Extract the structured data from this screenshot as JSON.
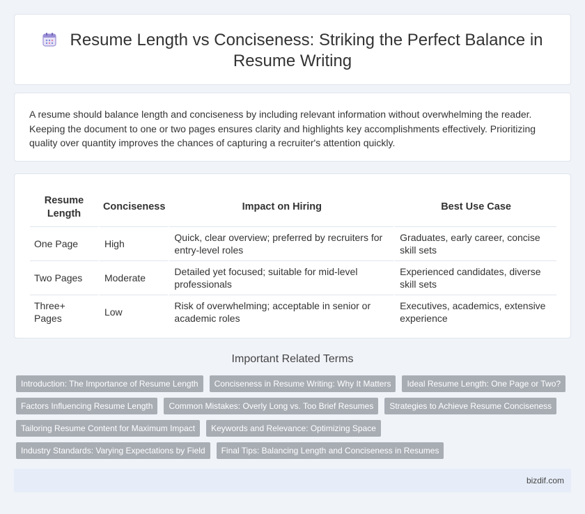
{
  "header": {
    "title": "Resume Length vs Conciseness: Striking the Perfect Balance in Resume Writing",
    "icon": "calendar-icon"
  },
  "intro": {
    "text": "A resume should balance length and conciseness by including relevant information without overwhelming the reader. Keeping the document to one or two pages ensures clarity and highlights key accomplishments effectively. Prioritizing quality over quantity improves the chances of capturing a recruiter's attention quickly."
  },
  "table": {
    "headers": [
      "Resume Length",
      "Conciseness",
      "Impact on Hiring",
      "Best Use Case"
    ],
    "rows": [
      [
        "One Page",
        "High",
        "Quick, clear overview; preferred by recruiters for entry-level roles",
        "Graduates, early career, concise skill sets"
      ],
      [
        "Two Pages",
        "Moderate",
        "Detailed yet focused; suitable for mid-level professionals",
        "Experienced candidates, diverse skill sets"
      ],
      [
        "Three+ Pages",
        "Low",
        "Risk of overwhelming; acceptable in senior or academic roles",
        "Executives, academics, extensive experience"
      ]
    ]
  },
  "related": {
    "title": "Important Related Terms",
    "tags": [
      [
        "Introduction: The Importance of Resume Length",
        "Conciseness in Resume Writing: Why It Matters",
        "Ideal Resume Length: One Page or Two?"
      ],
      [
        "Factors Influencing Resume Length",
        "Common Mistakes: Overly Long vs. Too Brief Resumes",
        "Strategies to Achieve Resume Conciseness"
      ],
      [
        "Tailoring Resume Content for Maximum Impact",
        "Keywords and Relevance: Optimizing Space"
      ],
      [
        "Industry Standards: Varying Expectations by Field",
        "Final Tips: Balancing Length and Conciseness in Resumes"
      ]
    ]
  },
  "footer": {
    "site": "bizdif.com"
  },
  "colors": {
    "tag_bg": "#a8adb4",
    "page_bg": "#f0f3f8",
    "footer_bg": "#e6edf8"
  }
}
